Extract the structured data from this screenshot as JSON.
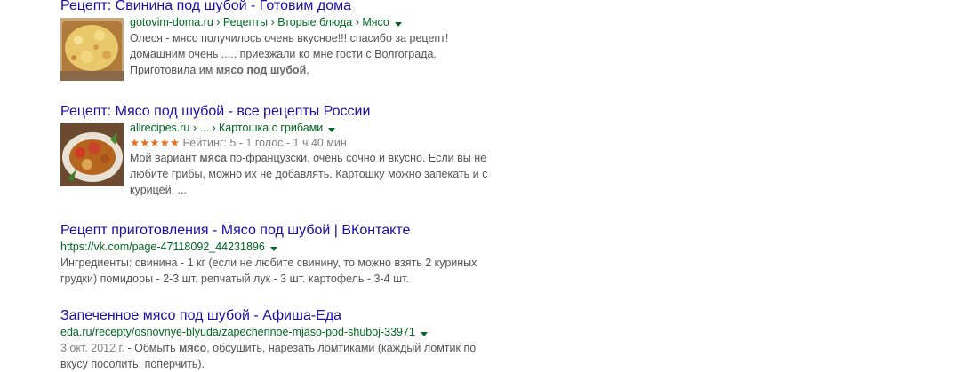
{
  "results": [
    {
      "title": "Рецепт: Свинина под шубой - Готовим дома",
      "url": "gotovim-doma.ru › Рецепты › Вторые блюда › Мясо",
      "snippet_a": "Олеся - мясо получилось очень вкусное!!! спасибо за рецепт! домашним очень ..... приезжали ко мне гости с Волгограда. Приготовила им ",
      "snippet_bold": "мясо под шубой",
      "snippet_b": "."
    },
    {
      "title": "Рецепт: Мясо под шубой - все рецепты России",
      "url": "allrecipes.ru › ... › Картошка с грибами",
      "stars": "★★★★★",
      "rating": "Рейтинг: 5 - 1 голос - 1 ч 40 мин",
      "rating_value": 5,
      "snippet_a": "Мой вариант ",
      "snippet_bold": "мяса",
      "snippet_b": " по-французски, очень сочно и вкусно. Если вы не любите грибы, можно их не добавлять. Картошку можно запекать и с курицей, ..."
    },
    {
      "title": "Рецепт приготовления - Мясо под шубой | ВКонтакте",
      "url": "https://vk.com/page-47118092_44231896",
      "snippet": "Ингредиенты: свинина - 1 кг (если не любите свинину, то можно взять 2 куриных грудки) помидоры - 2-3 шт. репчатый лук - 3 шт. картофель - 3-4 шт."
    },
    {
      "title": "Запеченное мясо под шубой - Афиша-Еда",
      "url": "eda.ru/recepty/osnovnye-blyuda/zapechennoe-mjaso-pod-shuboj-33971",
      "date": "3 окт. 2012 г.",
      "snippet_a": " - Обмыть ",
      "snippet_bold": "мясо",
      "snippet_b": ", обсушить, нарезать ломтиками (каждый ломтик по вкусу посолить, поперчить)."
    }
  ]
}
